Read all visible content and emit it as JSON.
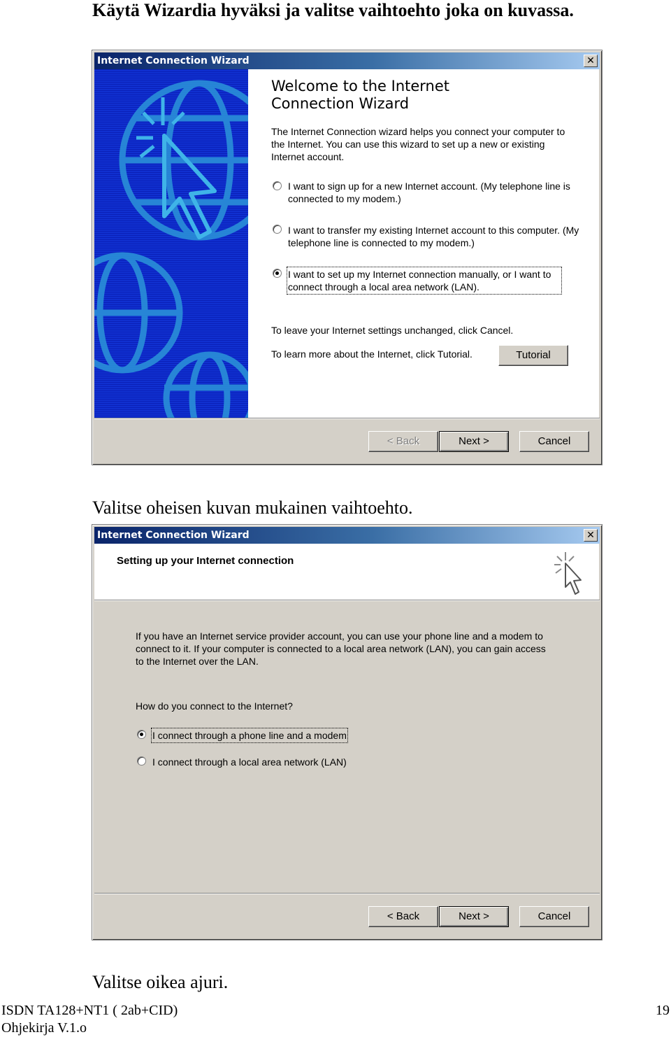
{
  "doc": {
    "heading1": "Käytä Wizardia hyväksi ja valitse vaihtoehto joka on kuvassa.",
    "heading2": "Valitse oheisen kuvan mukainen vaihtoehto.",
    "heading3": "Valitse oikea ajuri.",
    "footer_line1": "ISDN TA128+NT1 ( 2ab+CID)",
    "footer_line2": "Ohjekirja V.1.o",
    "page_number": "19"
  },
  "dialog1": {
    "title": "Internet Connection Wizard",
    "close": "✕",
    "welcome_title_line1": "Welcome to the Internet",
    "welcome_title_line2": "Connection Wizard",
    "intro": "The Internet Connection wizard helps you connect your computer to the Internet.  You can use this wizard to set up a new or existing Internet account.",
    "options": [
      {
        "label": "I want to sign up for a new Internet account. (My telephone line is connected to my modem.)",
        "selected": false
      },
      {
        "label": "I want to transfer my existing Internet account to this computer. (My telephone line is connected to my modem.)",
        "selected": false
      },
      {
        "label": "I want to set up my Internet connection manually, or I want to connect through a local area network (LAN).",
        "selected": true
      }
    ],
    "cancel_hint": "To leave your Internet settings unchanged, click Cancel.",
    "tutorial_hint": "To learn more about the Internet, click Tutorial.",
    "tutorial_button": "Tutorial",
    "back_button": "< Back",
    "next_button": "Next >",
    "cancel_button": "Cancel"
  },
  "dialog2": {
    "title": "Internet Connection Wizard",
    "close": "✕",
    "header": "Setting up your Internet connection",
    "intro": "If you have an Internet service provider account, you can use your phone line and a modem to connect to it. If your computer is connected to a local area network (LAN), you can gain access to the Internet over the LAN.",
    "question": "How do you connect to the Internet?",
    "options": [
      {
        "label": "I connect through a phone line and a modem",
        "selected": true
      },
      {
        "label": "I connect through a local area network (LAN)",
        "selected": false
      }
    ],
    "back_button": "< Back",
    "next_button": "Next >",
    "cancel_button": "Cancel"
  },
  "colors": {
    "title_gradient_start": "#0a246a",
    "title_gradient_end": "#a6caf0",
    "dialog_face": "#d4d0c8",
    "banner_blue": "#1030d0"
  },
  "icons": [
    "globe-cursor-banner-icon",
    "cursor-sparkle-icon",
    "close-icon",
    "radio-icon"
  ]
}
